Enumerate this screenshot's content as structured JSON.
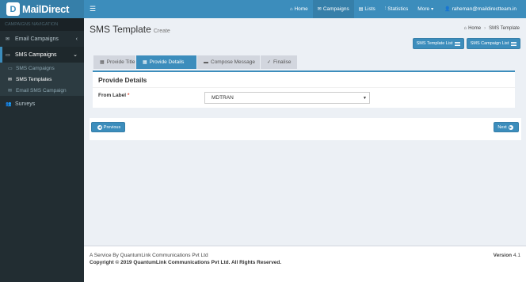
{
  "brand": {
    "logo_letter": "D",
    "name": "MailDirect"
  },
  "topnav": {
    "menu_icon": "hamburger-icon",
    "items": [
      {
        "label": "Home",
        "icon": "home-icon"
      },
      {
        "label": "Campaigns",
        "icon": "envelope-icon"
      },
      {
        "label": "Lists",
        "icon": "list-icon"
      },
      {
        "label": "Statistics",
        "icon": "chart-icon"
      },
      {
        "label": "More",
        "icon": "caret-down-icon"
      },
      {
        "label": "raheman@maildirectteam.in",
        "icon": "user-icon"
      }
    ]
  },
  "sidebar": {
    "header": "CAMPAIGNS NAVIGATION",
    "items": [
      {
        "label": "Email Campaigns"
      },
      {
        "label": "SMS Campaigns"
      },
      {
        "label": "SMS Campaigns"
      },
      {
        "label": "SMS Templates"
      },
      {
        "label": "Email SMS Campaign"
      },
      {
        "label": "Surveys"
      }
    ]
  },
  "page": {
    "title": "SMS Template",
    "subtitle": "Create"
  },
  "breadcrumb": {
    "home": "Home",
    "current": "SMS Template"
  },
  "actions": {
    "template_list": "SMS Template List",
    "campaign_list": "SMS Campaign List"
  },
  "steps": [
    {
      "label": "Provide Title"
    },
    {
      "label": "Provide Details"
    },
    {
      "label": "Compose Message"
    },
    {
      "label": "Finalise"
    }
  ],
  "panel": {
    "title": "Provide Details",
    "from_label": "From Label",
    "required_mark": "*",
    "from_value": "MDTRAN"
  },
  "nav": {
    "previous": "Previous",
    "next": "Next"
  },
  "footer": {
    "service": "A Service By QuantumLink Communications Pvt Ltd",
    "copyright": "Copyright © 2019 QuantumLink Communications Pvt Ltd. All Rights Reserved.",
    "version_label": "Version",
    "version": "4.1"
  },
  "colors": {
    "primary": "#3c8dbc",
    "primary_dark": "#367fa9",
    "sidebar": "#222d32",
    "step_inactive": "#d2d6de"
  }
}
